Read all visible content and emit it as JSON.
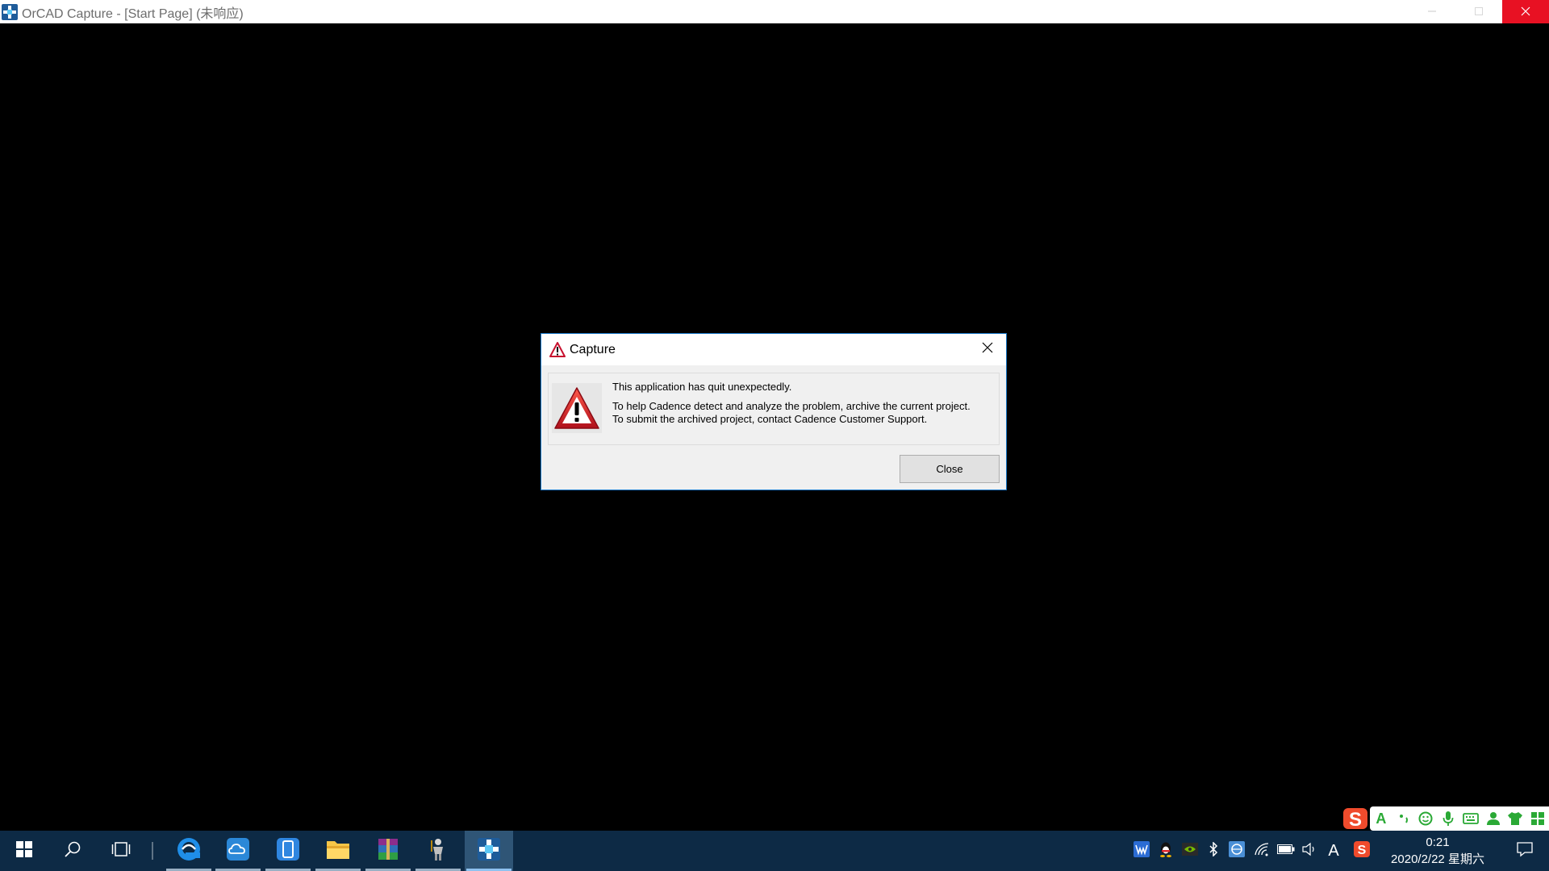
{
  "window": {
    "title": "OrCAD Capture - [Start Page] (未响应)",
    "icons": {
      "app": "orcad-capture-icon"
    },
    "controls": {
      "minimize": "minimize-icon",
      "maximize": "maximize-icon",
      "close": "close-icon"
    }
  },
  "dialog": {
    "title": "Capture",
    "icon": "warning-triangle-icon",
    "message_line1": "This application has quit unexpectedly.",
    "message_line2": "To help Cadence detect and analyze the problem, archive the current project.",
    "message_line3": "To submit the archived project, contact Cadence Customer Support.",
    "close_button_label": "Close",
    "close_icon": "close-icon"
  },
  "ime_toolbar": {
    "items": [
      "sogou-s-icon",
      "A",
      "punctuation-icon",
      "smiley-icon",
      "microphone-icon",
      "keyboard-icon",
      "user-icon",
      "shirt-icon",
      "grid-icon"
    ],
    "accent_color": "#2aa935"
  },
  "taskbar": {
    "pinned": [
      "start-icon",
      "search-icon",
      "task-view-icon",
      "edge-icon",
      "onedrive-icon",
      "phone-icon",
      "file-explorer-icon",
      "winrar-icon",
      "game-icon",
      "orcad-capture-icon"
    ],
    "tray": [
      "wps-icon",
      "qq-icon",
      "nvidia-icon",
      "bluetooth-icon",
      "network-app-icon",
      "wifi-icon",
      "battery-icon",
      "volume-icon",
      "A",
      "sogou-s-icon"
    ],
    "ime_letter": "A",
    "time": "0:21",
    "date": "2020/2/22 星期六",
    "notification_icon": "notification-icon"
  },
  "colors": {
    "taskbar_bg": "#0d2a45",
    "dialog_border": "#1979ca",
    "window_close_bg": "#e81123",
    "warning_red": "#c8102e"
  }
}
